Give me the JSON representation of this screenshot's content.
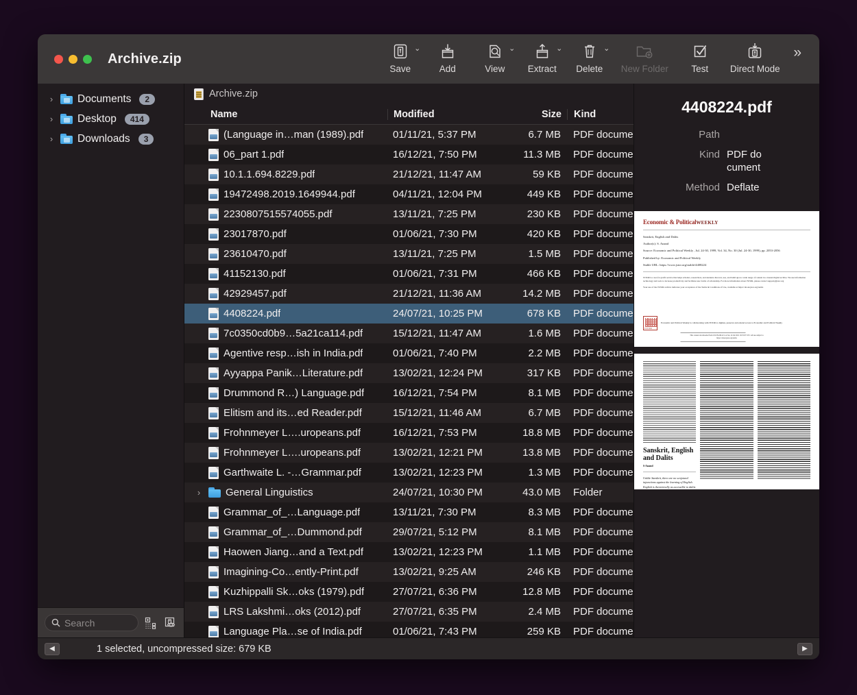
{
  "window": {
    "title": "Archive.zip",
    "traffic_lights": [
      "close-button",
      "minimize-button",
      "zoom-button"
    ]
  },
  "toolbar": {
    "items": [
      {
        "label": "Save",
        "icon": "save-archive-icon",
        "has_menu": true,
        "disabled": false
      },
      {
        "label": "Add",
        "icon": "add-to-archive-icon",
        "has_menu": false,
        "disabled": false
      },
      {
        "label": "View",
        "icon": "view-inspect-icon",
        "has_menu": true,
        "disabled": false
      },
      {
        "label": "Extract",
        "icon": "extract-icon",
        "has_menu": true,
        "disabled": false
      },
      {
        "label": "Delete",
        "icon": "trash-icon",
        "has_menu": true,
        "disabled": false
      },
      {
        "label": "New Folder",
        "icon": "new-folder-icon",
        "has_menu": false,
        "disabled": true
      },
      {
        "label": "Test",
        "icon": "checkmark-box-icon",
        "has_menu": false,
        "disabled": false
      },
      {
        "label": "Direct Mode",
        "icon": "direct-mode-icon",
        "has_menu": false,
        "disabled": false
      }
    ],
    "overflow_label": "»"
  },
  "sidebar": {
    "items": [
      {
        "label": "Documents",
        "badge": "2",
        "icon": "folder-documents-icon"
      },
      {
        "label": "Desktop",
        "badge": "414",
        "icon": "folder-desktop-icon"
      },
      {
        "label": "Downloads",
        "badge": "3",
        "icon": "folder-downloads-icon"
      }
    ],
    "search": {
      "placeholder": "Search",
      "value": "",
      "icon": "search-icon"
    },
    "bottom_icons": [
      "select-items-icon",
      "quick-look-icon"
    ]
  },
  "breadcrumb": {
    "label": "Archive.zip",
    "icon": "zip-file-icon"
  },
  "columns": {
    "name": "Name",
    "modified": "Modified",
    "size": "Size",
    "kind": "Kind"
  },
  "rows": [
    {
      "name": "(Language in…man (1989).pdf",
      "modified": "01/11/21, 5:37 PM",
      "size": "6.7 MB",
      "kind": "PDF document",
      "type": "file",
      "selected": false
    },
    {
      "name": "06_part 1.pdf",
      "modified": "16/12/21, 7:50 PM",
      "size": "11.3 MB",
      "kind": "PDF document",
      "type": "file",
      "selected": false
    },
    {
      "name": "10.1.1.694.8229.pdf",
      "modified": "21/12/21, 11:47 AM",
      "size": "59 KB",
      "kind": "PDF document",
      "type": "file",
      "selected": false
    },
    {
      "name": "19472498.2019.1649944.pdf",
      "modified": "04/11/21, 12:04 PM",
      "size": "449 KB",
      "kind": "PDF document",
      "type": "file",
      "selected": false
    },
    {
      "name": "2230807515574055.pdf",
      "modified": "13/11/21, 7:25 PM",
      "size": "230 KB",
      "kind": "PDF document",
      "type": "file",
      "selected": false
    },
    {
      "name": "23017870.pdf",
      "modified": "01/06/21, 7:30 PM",
      "size": "420 KB",
      "kind": "PDF document",
      "type": "file",
      "selected": false
    },
    {
      "name": "23610470.pdf",
      "modified": "13/11/21, 7:25 PM",
      "size": "1.5 MB",
      "kind": "PDF document",
      "type": "file",
      "selected": false
    },
    {
      "name": "41152130.pdf",
      "modified": "01/06/21, 7:31 PM",
      "size": "466 KB",
      "kind": "PDF document",
      "type": "file",
      "selected": false
    },
    {
      "name": "42929457.pdf",
      "modified": "21/12/21, 11:36 AM",
      "size": "14.2 MB",
      "kind": "PDF document",
      "type": "file",
      "selected": false
    },
    {
      "name": "4408224.pdf",
      "modified": "24/07/21, 10:25 PM",
      "size": "678 KB",
      "kind": "PDF document",
      "type": "file",
      "selected": true
    },
    {
      "name": "7c0350cd0b9…5a21ca114.pdf",
      "modified": "15/12/21, 11:47 AM",
      "size": "1.6 MB",
      "kind": "PDF document",
      "type": "file",
      "selected": false
    },
    {
      "name": "Agentive resp…ish in India.pdf",
      "modified": "01/06/21, 7:40 PM",
      "size": "2.2 MB",
      "kind": "PDF document",
      "type": "file",
      "selected": false
    },
    {
      "name": "Ayyappa Panik…Literature.pdf",
      "modified": "13/02/21, 12:24 PM",
      "size": "317 KB",
      "kind": "PDF document",
      "type": "file",
      "selected": false
    },
    {
      "name": "Drummond R…) Language.pdf",
      "modified": "16/12/21, 7:54 PM",
      "size": "8.1 MB",
      "kind": "PDF document",
      "type": "file",
      "selected": false
    },
    {
      "name": "Elitism and its…ed Reader.pdf",
      "modified": "15/12/21, 11:46 AM",
      "size": "6.7 MB",
      "kind": "PDF document",
      "type": "file",
      "selected": false
    },
    {
      "name": "Frohnmeyer L….uropeans.pdf",
      "modified": "16/12/21, 7:53 PM",
      "size": "18.8 MB",
      "kind": "PDF document",
      "type": "file",
      "selected": false
    },
    {
      "name": "Frohnmeyer L….uropeans.pdf",
      "modified": "13/02/21, 12:21 PM",
      "size": "13.8 MB",
      "kind": "PDF document",
      "type": "file",
      "selected": false
    },
    {
      "name": "Garthwaite L. -…Grammar.pdf",
      "modified": "13/02/21, 12:23 PM",
      "size": "1.3 MB",
      "kind": "PDF document",
      "type": "file",
      "selected": false
    },
    {
      "name": "General Linguistics",
      "modified": "24/07/21, 10:30 PM",
      "size": "43.0 MB",
      "kind": "Folder",
      "type": "folder",
      "selected": false
    },
    {
      "name": "Grammar_of_…Language.pdf",
      "modified": "13/11/21, 7:30 PM",
      "size": "8.3 MB",
      "kind": "PDF document",
      "type": "file",
      "selected": false
    },
    {
      "name": "Grammar_of_…Dummond.pdf",
      "modified": "29/07/21, 5:12 PM",
      "size": "8.1 MB",
      "kind": "PDF document",
      "type": "file",
      "selected": false
    },
    {
      "name": "Haowen Jiang…and a Text.pdf",
      "modified": "13/02/21, 12:23 PM",
      "size": "1.1 MB",
      "kind": "PDF document",
      "type": "file",
      "selected": false
    },
    {
      "name": "Imagining-Co…ently-Print.pdf",
      "modified": "13/02/21, 9:25 AM",
      "size": "246 KB",
      "kind": "PDF document",
      "type": "file",
      "selected": false
    },
    {
      "name": "Kuzhippalli Sk…oks (1979).pdf",
      "modified": "27/07/21, 6:36 PM",
      "size": "12.8 MB",
      "kind": "PDF document",
      "type": "file",
      "selected": false
    },
    {
      "name": "LRS Lakshmi…oks (2012).pdf",
      "modified": "27/07/21, 6:35 PM",
      "size": "2.4 MB",
      "kind": "PDF document",
      "type": "file",
      "selected": false
    },
    {
      "name": "Language Pla…se of India.pdf",
      "modified": "01/06/21, 7:43 PM",
      "size": "259 KB",
      "kind": "PDF document",
      "type": "file",
      "selected": false
    }
  ],
  "info_panel": {
    "title": "4408224.pdf",
    "fields": [
      {
        "key": "Path",
        "value": ""
      },
      {
        "key": "Kind",
        "value": "PDF document"
      },
      {
        "key": "Method",
        "value": "Deflate"
      }
    ],
    "preview": {
      "page1": {
        "journal": "Economic & Political",
        "journal_suffix": "WEEKLY",
        "title_line": "Sanskrit, English and Dalits",
        "author_line": "Author(s): S. Anand",
        "source_line": "Source: Economic and Political Weekly , Jul. 24-30, 1999, Vol. 34, No. 30 (Jul. 24-30, 1999), pp. 2053-2056",
        "published_line": "Published by: Economic and Political Weekly",
        "url_line": "Stable URL: https://www.jstor.org/stable/4408224",
        "blurb1": "JSTOR is a not-for-profit service that helps scholars, researchers, and students discover, use, and build upon a wide range of content in a trusted digital archive. We use information technology and tools to increase productivity and facilitate new forms of scholarship. For more information about JSTOR, please contact support@jstor.org",
        "blurb2": "Your use of the JSTOR archive indicates your acceptance of the Terms & Conditions of Use, available at https://about.jstor.org/terms",
        "collab": "Economic and Political Weekly is collaborating with JSTOR to digitize, preserve and extend access to Economic and Political Weekly",
        "footer": "This content downloaded from 102.38.249.221 on Sat, 24 Jul 2021 16:55:07 UTC All use subject to https://about.jstor.org/terms"
      },
      "page2": {
        "article_title": "Sanskrit, English and Dalits",
        "byline": "S Anand",
        "lede": "Unlike Sanskrit, there are no scriptural injunctions against the learning of English. English is theoretically as accessible to dalits"
      }
    }
  },
  "status_bar": {
    "text": "1 selected, uncompressed size: 679 KB",
    "back_icon": "nav-back-icon",
    "forward_icon": "nav-forward-icon"
  }
}
